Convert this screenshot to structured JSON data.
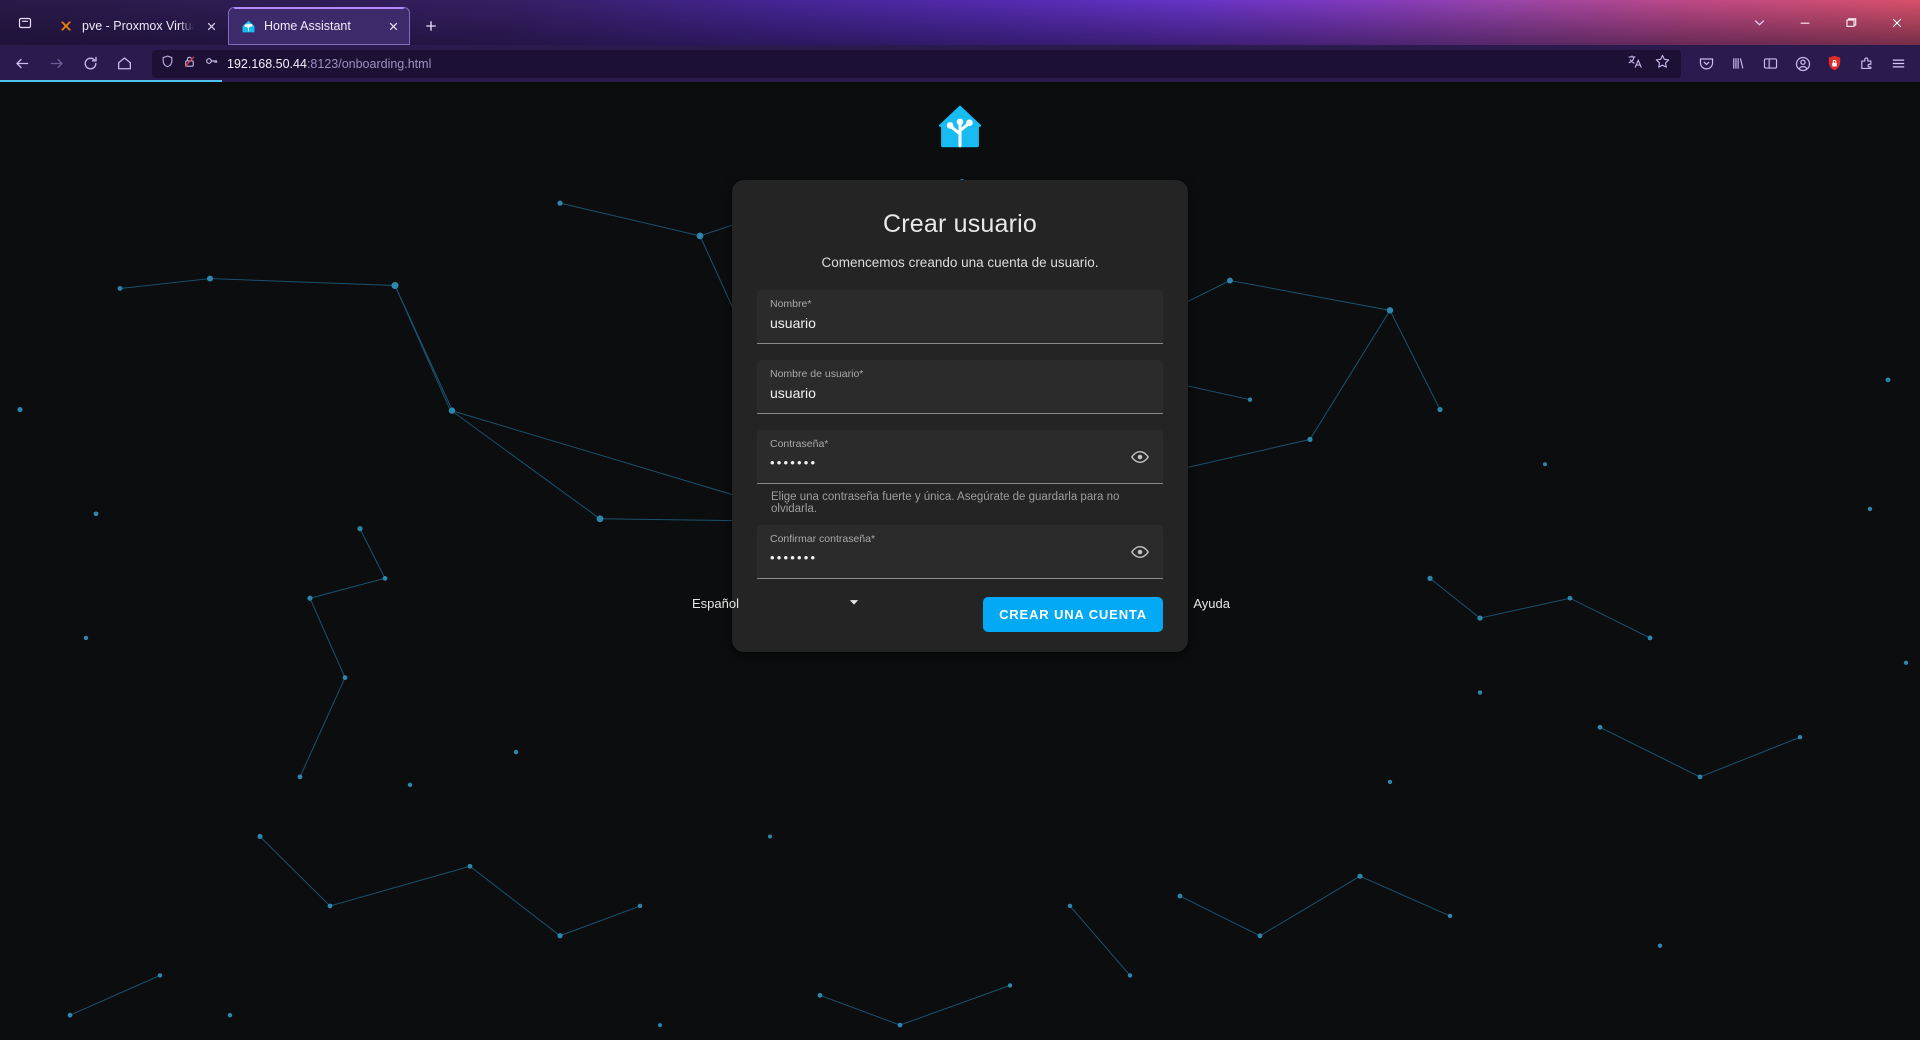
{
  "browser": {
    "tablist_icon": "tab-list-icon",
    "newtab_icon": "new-tab-icon",
    "tabs": [
      {
        "title": "pve - Proxmox Virtual Environm",
        "favicon": "proxmox-icon",
        "active": false,
        "close_icon": "close-icon"
      },
      {
        "title": "Home Assistant",
        "favicon": "home-assistant-icon",
        "active": true,
        "close_icon": "close-icon"
      }
    ],
    "window_controls": {
      "list_all_tabs_icon": "chevron-down-icon",
      "minimize_icon": "minimize-icon",
      "maximize_icon": "maximize-icon",
      "close_icon": "window-close-icon"
    },
    "nav": {
      "back_icon": "back-arrow-icon",
      "forward_icon": "forward-arrow-icon",
      "reload_icon": "reload-icon",
      "home_icon": "home-icon"
    },
    "urlbar": {
      "shield_icon": "shield-icon",
      "broken_lock_icon": "broken-lock-icon",
      "key_icon": "key-icon",
      "url_host": "192.168.50.44",
      "url_rest": ":8123/onboarding.html",
      "translate_icon": "translate-icon",
      "bookmark_icon": "bookmark-star-icon"
    },
    "toolbar_icons": [
      "pocket-icon",
      "library-icon",
      "sidebar-icon",
      "account-icon",
      "extension-shield-icon",
      "extensions-puzzle-icon",
      "app-menu-icon"
    ]
  },
  "page": {
    "logo": "home-assistant-logo",
    "card": {
      "title": "Crear usuario",
      "subtitle": "Comencemos creando una cuenta de usuario.",
      "fields": [
        {
          "label": "Nombre*",
          "value": "usuario",
          "type": "text",
          "toggle_icon": null,
          "helper": null
        },
        {
          "label": "Nombre de usuario*",
          "value": "usuario",
          "type": "text",
          "toggle_icon": null,
          "helper": null
        },
        {
          "label": "Contraseña*",
          "value": "•••••••",
          "type": "password",
          "toggle_icon": "eye-icon",
          "helper": "Elige una contraseña fuerte y única. Asegúrate de guardarla para no olvidarla."
        },
        {
          "label": "Confirmar contraseña*",
          "value": "•••••••",
          "type": "password",
          "toggle_icon": "eye-icon",
          "helper": null
        }
      ],
      "submit_label": "CREAR UNA CUENTA"
    },
    "footer": {
      "language": "Español",
      "language_caret_icon": "caret-down-icon",
      "help_label": "Ayuda"
    },
    "colors": {
      "accent": "#03a9f4",
      "card_bg": "#242424",
      "page_bg": "#0b0d0e",
      "star": "#2b7fa8"
    }
  }
}
